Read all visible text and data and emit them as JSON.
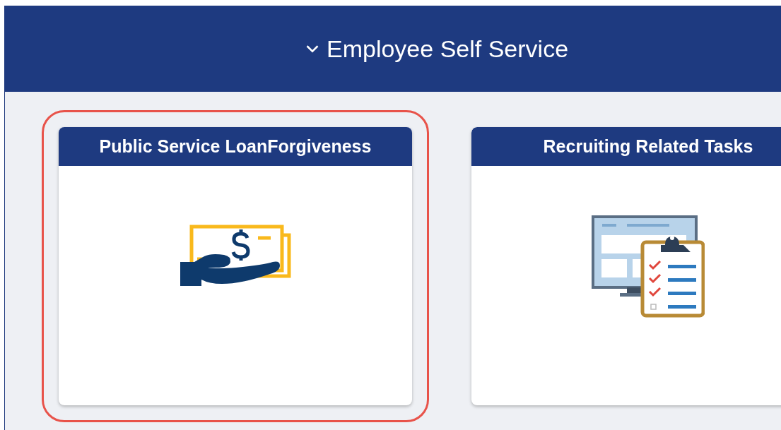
{
  "banner": {
    "title": "Employee Self Service",
    "expanded": true
  },
  "tiles": [
    {
      "title": "Public Service LoanForgiveness",
      "kind": "money",
      "highlighted": true
    },
    {
      "title": "Recruiting Related Tasks",
      "kind": "checklist",
      "highlighted": false
    }
  ]
}
